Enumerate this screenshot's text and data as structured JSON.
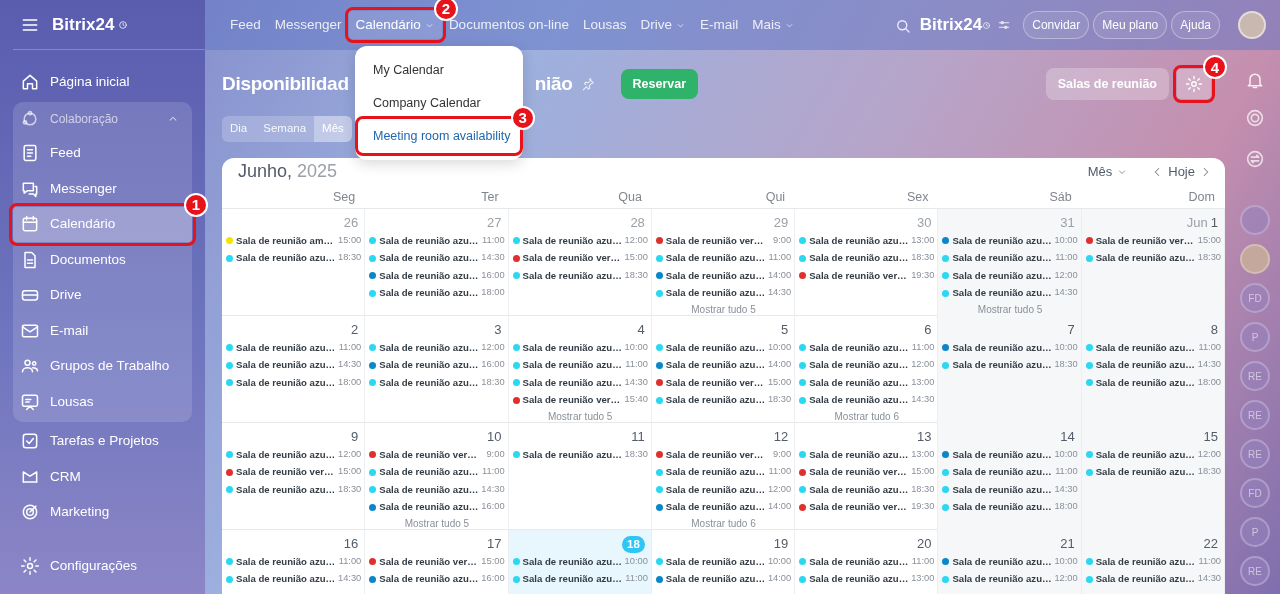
{
  "sidebar": {
    "logo": "Bitrix24",
    "items": [
      {
        "kind": "item",
        "label": "Página inicial",
        "selected": false
      },
      {
        "kind": "group",
        "label": "Colaboração",
        "expanded": true,
        "children": [
          {
            "label": "Feed",
            "selected": false
          },
          {
            "label": "Messenger",
            "selected": false
          },
          {
            "label": "Calendário",
            "selected": true,
            "callout": "1"
          },
          {
            "label": "Documentos",
            "selected": false
          },
          {
            "label": "Drive",
            "selected": false
          },
          {
            "label": "E-mail",
            "selected": false
          },
          {
            "label": "Grupos de Trabalho",
            "selected": false
          },
          {
            "label": "Lousas",
            "selected": false
          }
        ]
      },
      {
        "kind": "item",
        "label": "Tarefas e Projetos",
        "selected": false
      },
      {
        "kind": "item",
        "label": "CRM",
        "selected": false
      },
      {
        "kind": "item",
        "label": "Marketing",
        "selected": false
      }
    ],
    "footer": "Configurações"
  },
  "topnav": {
    "items": [
      {
        "label": "Feed",
        "selected": false,
        "has_menu": false
      },
      {
        "label": "Messenger",
        "selected": false,
        "has_menu": false
      },
      {
        "label": "Calendário",
        "selected": true,
        "has_menu": true,
        "callout": "2"
      },
      {
        "label": "Documentos on-line",
        "selected": false,
        "has_menu": false
      },
      {
        "label": "Lousas",
        "selected": false,
        "has_menu": false
      },
      {
        "label": "Drive",
        "selected": false,
        "has_menu": true
      },
      {
        "label": "E-mail",
        "selected": false,
        "has_menu": false
      },
      {
        "label": "Mais",
        "selected": false,
        "has_menu": true
      }
    ],
    "logo": "Bitrix24",
    "buttons": [
      "Convidar",
      "Meu plano",
      "Ajuda"
    ]
  },
  "menu": {
    "items": [
      {
        "label": "My Calendar",
        "selected": false
      },
      {
        "label": "Company Calendar",
        "selected": false
      },
      {
        "label": "Meeting room availability",
        "selected": true,
        "callout": "3"
      }
    ]
  },
  "page": {
    "title_parts": [
      "Disponibilidad",
      "nião"
    ],
    "primary_button": "Reservar",
    "rooms_button": "Salas de reunião",
    "settings_callout": "4",
    "view_tabs": [
      {
        "label": "Dia",
        "selected": false
      },
      {
        "label": "Semana",
        "selected": false
      },
      {
        "label": "Mês",
        "selected": true
      }
    ]
  },
  "calendar": {
    "month": "Junho,",
    "year": "2025",
    "view_select": "Mês",
    "today_button": "Hoje",
    "weekdays": [
      "Seg",
      "Ter",
      "Qua",
      "Qui",
      "Sex",
      "Sáb",
      "Dom"
    ],
    "weeks": [
      [
        {
          "day": "26",
          "outside": true,
          "today": false,
          "events": [
            {
              "name": "Sala de reunião am…",
              "time": "15:00",
              "color": "#f2e600"
            },
            {
              "name": "Sala de reunião azu…",
              "time": "18:30",
              "color": "#2ad8f2"
            }
          ]
        },
        {
          "day": "27",
          "outside": true,
          "today": false,
          "events": [
            {
              "name": "Sala de reunião azu…",
              "time": "11:00",
              "color": "#2ad8f2"
            },
            {
              "name": "Sala de reunião azu…",
              "time": "14:30",
              "color": "#2ad8f2"
            },
            {
              "name": "Sala de reunião azu…",
              "time": "16:00",
              "color": "#0a86c9"
            },
            {
              "name": "Sala de reunião azu…",
              "time": "18:00",
              "color": "#2ad8f2"
            }
          ]
        },
        {
          "day": "28",
          "outside": true,
          "today": false,
          "events": [
            {
              "name": "Sala de reunião azu…",
              "time": "12:00",
              "color": "#2ad8f2"
            },
            {
              "name": "Sala de reunião ver…",
              "time": "15:00",
              "color": "#e0302e"
            },
            {
              "name": "Sala de reunião azu…",
              "time": "18:30",
              "color": "#2ad8f2"
            }
          ]
        },
        {
          "day": "29",
          "outside": true,
          "today": false,
          "events": [
            {
              "name": "Sala de reunião ver…",
              "time": "9:00",
              "color": "#e0302e"
            },
            {
              "name": "Sala de reunião azu…",
              "time": "11:00",
              "color": "#2ad8f2"
            },
            {
              "name": "Sala de reunião azu…",
              "time": "14:00",
              "color": "#0a86c9"
            },
            {
              "name": "Sala de reunião azu…",
              "time": "14:30",
              "color": "#2ad8f2"
            }
          ],
          "more": "Mostrar tudo 5"
        },
        {
          "day": "30",
          "outside": true,
          "today": false,
          "events": [
            {
              "name": "Sala de reunião azu…",
              "time": "13:00",
              "color": "#2ad8f2"
            },
            {
              "name": "Sala de reunião azu…",
              "time": "18:30",
              "color": "#2ad8f2"
            },
            {
              "name": "Sala de reunião ver…",
              "time": "19:30",
              "color": "#e0302e"
            }
          ]
        },
        {
          "day": "31",
          "outside": true,
          "today": false,
          "events": [
            {
              "name": "Sala de reunião azu…",
              "time": "10:00",
              "color": "#0a86c9"
            },
            {
              "name": "Sala de reunião azu…",
              "time": "11:00",
              "color": "#2ad8f2"
            },
            {
              "name": "Sala de reunião azu…",
              "time": "12:00",
              "color": "#2ad8f2"
            },
            {
              "name": "Sala de reunião azu…",
              "time": "14:30",
              "color": "#2ad8f2"
            }
          ],
          "more": "Mostrar tudo 5"
        },
        {
          "month": "Jun",
          "day": "1",
          "outside": false,
          "today": false,
          "events": [
            {
              "name": "Sala de reunião ver…",
              "time": "15:00",
              "color": "#e0302e"
            },
            {
              "name": "Sala de reunião azu…",
              "time": "18:30",
              "color": "#2ad8f2"
            }
          ]
        }
      ],
      [
        {
          "day": "2",
          "outside": false,
          "today": false,
          "events": [
            {
              "name": "Sala de reunião azu…",
              "time": "11:00",
              "color": "#2ad8f2"
            },
            {
              "name": "Sala de reunião azu…",
              "time": "14:30",
              "color": "#2ad8f2"
            },
            {
              "name": "Sala de reunião azu…",
              "time": "18:00",
              "color": "#2ad8f2"
            }
          ]
        },
        {
          "day": "3",
          "outside": false,
          "today": false,
          "events": [
            {
              "name": "Sala de reunião azu…",
              "time": "12:00",
              "color": "#2ad8f2"
            },
            {
              "name": "Sala de reunião azu…",
              "time": "16:00",
              "color": "#0a86c9"
            },
            {
              "name": "Sala de reunião azu…",
              "time": "18:30",
              "color": "#2ad8f2"
            }
          ]
        },
        {
          "day": "4",
          "outside": false,
          "today": false,
          "events": [
            {
              "name": "Sala de reunião azu…",
              "time": "10:00",
              "color": "#2ad8f2"
            },
            {
              "name": "Sala de reunião azu…",
              "time": "11:00",
              "color": "#2ad8f2"
            },
            {
              "name": "Sala de reunião azu…",
              "time": "14:30",
              "color": "#2ad8f2"
            },
            {
              "name": "Sala de reunião ver…",
              "time": "15:40",
              "color": "#e0302e"
            }
          ],
          "more": "Mostrar tudo 5"
        },
        {
          "day": "5",
          "outside": false,
          "today": false,
          "events": [
            {
              "name": "Sala de reunião azu…",
              "time": "10:00",
              "color": "#2ad8f2"
            },
            {
              "name": "Sala de reunião azu…",
              "time": "14:00",
              "color": "#0a86c9"
            },
            {
              "name": "Sala de reunião ver…",
              "time": "15:00",
              "color": "#e0302e"
            },
            {
              "name": "Sala de reunião azu…",
              "time": "18:30",
              "color": "#2ad8f2"
            }
          ]
        },
        {
          "day": "6",
          "outside": false,
          "today": false,
          "events": [
            {
              "name": "Sala de reunião azu…",
              "time": "11:00",
              "color": "#2ad8f2"
            },
            {
              "name": "Sala de reunião azu…",
              "time": "12:00",
              "color": "#2ad8f2"
            },
            {
              "name": "Sala de reunião azu…",
              "time": "13:00",
              "color": "#2ad8f2"
            },
            {
              "name": "Sala de reunião azu…",
              "time": "14:30",
              "color": "#2ad8f2"
            }
          ],
          "more": "Mostrar tudo 6"
        },
        {
          "day": "7",
          "outside": false,
          "today": false,
          "events": [
            {
              "name": "Sala de reunião azu…",
              "time": "10:00",
              "color": "#0a86c9"
            },
            {
              "name": "Sala de reunião azu…",
              "time": "18:30",
              "color": "#2ad8f2"
            }
          ]
        },
        {
          "day": "8",
          "outside": false,
          "today": false,
          "events": [
            {
              "name": "Sala de reunião azu…",
              "time": "11:00",
              "color": "#2ad8f2"
            },
            {
              "name": "Sala de reunião azu…",
              "time": "14:30",
              "color": "#2ad8f2"
            },
            {
              "name": "Sala de reunião azu…",
              "time": "18:00",
              "color": "#2ad8f2"
            }
          ]
        }
      ],
      [
        {
          "day": "9",
          "outside": false,
          "today": false,
          "events": [
            {
              "name": "Sala de reunião azu…",
              "time": "12:00",
              "color": "#2ad8f2"
            },
            {
              "name": "Sala de reunião ver…",
              "time": "15:00",
              "color": "#e0302e"
            },
            {
              "name": "Sala de reunião azu…",
              "time": "18:30",
              "color": "#2ad8f2"
            }
          ]
        },
        {
          "day": "10",
          "outside": false,
          "today": false,
          "events": [
            {
              "name": "Sala de reunião ver…",
              "time": "9:00",
              "color": "#e0302e"
            },
            {
              "name": "Sala de reunião azu…",
              "time": "11:00",
              "color": "#2ad8f2"
            },
            {
              "name": "Sala de reunião azu…",
              "time": "14:30",
              "color": "#2ad8f2"
            },
            {
              "name": "Sala de reunião azu…",
              "time": "16:00",
              "color": "#0a86c9"
            }
          ],
          "more": "Mostrar tudo 5"
        },
        {
          "day": "11",
          "outside": false,
          "today": false,
          "events": [
            {
              "name": "Sala de reunião azu…",
              "time": "18:30",
              "color": "#2ad8f2"
            }
          ]
        },
        {
          "day": "12",
          "outside": false,
          "today": false,
          "events": [
            {
              "name": "Sala de reunião ver…",
              "time": "9:00",
              "color": "#e0302e"
            },
            {
              "name": "Sala de reunião azu…",
              "time": "11:00",
              "color": "#2ad8f2"
            },
            {
              "name": "Sala de reunião azu…",
              "time": "12:00",
              "color": "#2ad8f2"
            },
            {
              "name": "Sala de reunião azu…",
              "time": "14:00",
              "color": "#0a86c9"
            }
          ],
          "more": "Mostrar tudo 6"
        },
        {
          "day": "13",
          "outside": false,
          "today": false,
          "events": [
            {
              "name": "Sala de reunião azu…",
              "time": "13:00",
              "color": "#2ad8f2"
            },
            {
              "name": "Sala de reunião ver…",
              "time": "15:00",
              "color": "#e0302e"
            },
            {
              "name": "Sala de reunião azu…",
              "time": "18:30",
              "color": "#2ad8f2"
            },
            {
              "name": "Sala de reunião ver…",
              "time": "19:30",
              "color": "#e0302e"
            }
          ]
        },
        {
          "day": "14",
          "outside": false,
          "today": false,
          "events": [
            {
              "name": "Sala de reunião azu…",
              "time": "10:00",
              "color": "#0a86c9"
            },
            {
              "name": "Sala de reunião azu…",
              "time": "11:00",
              "color": "#2ad8f2"
            },
            {
              "name": "Sala de reunião azu…",
              "time": "14:30",
              "color": "#2ad8f2"
            },
            {
              "name": "Sala de reunião azu…",
              "time": "18:00",
              "color": "#2ad8f2"
            }
          ]
        },
        {
          "day": "15",
          "outside": false,
          "today": false,
          "events": [
            {
              "name": "Sala de reunião azu…",
              "time": "12:00",
              "color": "#2ad8f2"
            },
            {
              "name": "Sala de reunião azu…",
              "time": "18:30",
              "color": "#2ad8f2"
            }
          ]
        }
      ],
      [
        {
          "day": "16",
          "outside": false,
          "today": false,
          "events": [
            {
              "name": "Sala de reunião azu…",
              "time": "11:00",
              "color": "#2ad8f2"
            },
            {
              "name": "Sala de reunião azu…",
              "time": "14:30",
              "color": "#2ad8f2"
            }
          ]
        },
        {
          "day": "17",
          "outside": false,
          "today": false,
          "events": [
            {
              "name": "Sala de reunião ver…",
              "time": "15:00",
              "color": "#e0302e"
            },
            {
              "name": "Sala de reunião azu…",
              "time": "16:00",
              "color": "#0a86c9"
            }
          ]
        },
        {
          "day": "18",
          "outside": false,
          "today": true,
          "events": [
            {
              "name": "Sala de reunião azu…",
              "time": "10:00",
              "color": "#2ad8f2"
            },
            {
              "name": "Sala de reunião azu…",
              "time": "11:00",
              "color": "#2ad8f2"
            }
          ]
        },
        {
          "day": "19",
          "outside": false,
          "today": false,
          "events": [
            {
              "name": "Sala de reunião azu…",
              "time": "10:00",
              "color": "#2ad8f2"
            },
            {
              "name": "Sala de reunião azu…",
              "time": "14:00",
              "color": "#0a86c9"
            }
          ]
        },
        {
          "day": "20",
          "outside": false,
          "today": false,
          "events": [
            {
              "name": "Sala de reunião azu…",
              "time": "11:00",
              "color": "#2ad8f2"
            },
            {
              "name": "Sala de reunião azu…",
              "time": "13:00",
              "color": "#2ad8f2"
            }
          ]
        },
        {
          "day": "21",
          "outside": false,
          "today": false,
          "events": [
            {
              "name": "Sala de reunião azu…",
              "time": "10:00",
              "color": "#0a86c9"
            },
            {
              "name": "Sala de reunião azu…",
              "time": "12:00",
              "color": "#2ad8f2"
            }
          ]
        },
        {
          "day": "22",
          "outside": false,
          "today": false,
          "events": [
            {
              "name": "Sala de reunião azu…",
              "time": "11:00",
              "color": "#2ad8f2"
            },
            {
              "name": "Sala de reunião azu…",
              "time": "14:30",
              "color": "#2ad8f2"
            }
          ]
        }
      ]
    ]
  },
  "right_rail": {
    "avatars": [
      {
        "initials": "FD"
      },
      {
        "initials": "P"
      },
      {
        "initials": "RE"
      },
      {
        "initials": "RE"
      },
      {
        "initials": "RE"
      },
      {
        "initials": "FD"
      },
      {
        "initials": "P"
      },
      {
        "initials": "RE"
      }
    ]
  }
}
